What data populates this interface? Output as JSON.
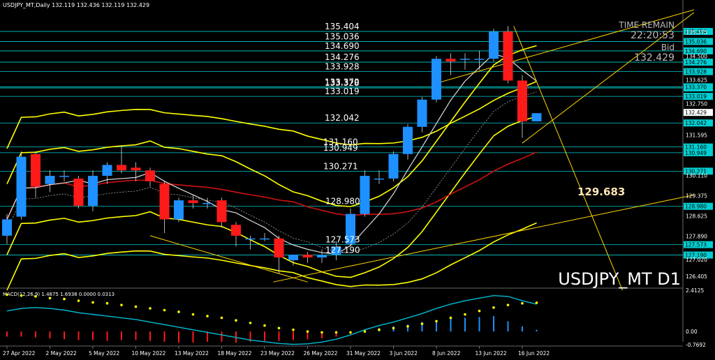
{
  "header": {
    "symbol_title": "USDJPY_MT,Daily  132.119 132.436 132.119 132.429"
  },
  "info": {
    "time_remain_label": "TIME REMAIN",
    "time_remain_value": "22:20:53",
    "bid_label": "Bid",
    "bid_value": "132.429"
  },
  "watermark": "USDJPY_MT D1",
  "target_label": "129.683",
  "colors": {
    "bg": "#000000",
    "bull": "#1e90ff",
    "bear": "#ff1a1a",
    "level": "#00ced1",
    "yellow": "#ffff00",
    "trend": "#ffd700",
    "ma_red": "#cc1111",
    "ma_white": "#dddddd",
    "axis": "#ffffff",
    "macd_line": "#00bcd4",
    "macd_signal": "#ffff00"
  },
  "chart_data": {
    "type": "candlestick",
    "symbol": "USDJPY_MT",
    "timeframe": "Daily",
    "ylim": [
      126.0,
      136.2
    ],
    "price_ticks": [
      "135.375",
      "134.500",
      "133.625",
      "132.750",
      "131.595",
      "130.110",
      "129.375",
      "128.625",
      "127.890",
      "127.020",
      "126.405"
    ],
    "current_price": "132.429",
    "date_labels": [
      {
        "i": 0,
        "label": "27 Apr 2022"
      },
      {
        "i": 3,
        "label": "2 May 2022"
      },
      {
        "i": 6,
        "label": "5 May 2022"
      },
      {
        "i": 9,
        "label": "10 May 2022"
      },
      {
        "i": 12,
        "label": "13 May 2022"
      },
      {
        "i": 15,
        "label": "18 May 2022"
      },
      {
        "i": 18,
        "label": "23 May 2022"
      },
      {
        "i": 21,
        "label": "26 May 2022"
      },
      {
        "i": 24,
        "label": "31 May 2022"
      },
      {
        "i": 27,
        "label": "3 Jun 2022"
      },
      {
        "i": 30,
        "label": "8 Jun 2022"
      },
      {
        "i": 33,
        "label": "13 Jun 2022"
      },
      {
        "i": 36,
        "label": "16 Jun 2022"
      }
    ],
    "candles": [
      {
        "o": 127.9,
        "h": 128.7,
        "l": 127.6,
        "c": 128.5
      },
      {
        "o": 128.6,
        "h": 131.0,
        "l": 128.5,
        "c": 130.8
      },
      {
        "o": 130.9,
        "h": 131.0,
        "l": 129.3,
        "c": 129.7
      },
      {
        "o": 129.8,
        "h": 130.3,
        "l": 129.5,
        "c": 130.1
      },
      {
        "o": 130.1,
        "h": 130.3,
        "l": 129.9,
        "c": 130.1
      },
      {
        "o": 130.0,
        "h": 130.1,
        "l": 128.9,
        "c": 129.0
      },
      {
        "o": 129.0,
        "h": 130.3,
        "l": 128.8,
        "c": 130.1
      },
      {
        "o": 130.1,
        "h": 130.6,
        "l": 129.8,
        "c": 130.5
      },
      {
        "o": 130.5,
        "h": 131.2,
        "l": 130.2,
        "c": 130.3
      },
      {
        "o": 130.4,
        "h": 130.6,
        "l": 129.9,
        "c": 130.3
      },
      {
        "o": 130.3,
        "h": 130.4,
        "l": 129.7,
        "c": 129.9
      },
      {
        "o": 129.8,
        "h": 129.9,
        "l": 128.0,
        "c": 128.5
      },
      {
        "o": 128.5,
        "h": 129.3,
        "l": 128.4,
        "c": 129.2
      },
      {
        "o": 129.2,
        "h": 129.4,
        "l": 128.9,
        "c": 129.1
      },
      {
        "o": 129.1,
        "h": 129.3,
        "l": 128.9,
        "c": 129.1
      },
      {
        "o": 129.2,
        "h": 129.3,
        "l": 128.2,
        "c": 128.4
      },
      {
        "o": 128.3,
        "h": 128.4,
        "l": 127.5,
        "c": 127.9
      },
      {
        "o": 127.8,
        "h": 127.9,
        "l": 127.4,
        "c": 127.8
      },
      {
        "o": 127.8,
        "h": 128.0,
        "l": 127.7,
        "c": 127.8
      },
      {
        "o": 127.8,
        "h": 127.9,
        "l": 126.5,
        "c": 127.1
      },
      {
        "o": 127.0,
        "h": 127.2,
        "l": 126.8,
        "c": 127.2
      },
      {
        "o": 127.2,
        "h": 127.3,
        "l": 126.9,
        "c": 127.1
      },
      {
        "o": 127.1,
        "h": 127.4,
        "l": 126.9,
        "c": 127.2
      },
      {
        "o": 127.2,
        "h": 127.7,
        "l": 127.0,
        "c": 127.5
      },
      {
        "o": 127.6,
        "h": 128.9,
        "l": 127.5,
        "c": 128.7
      },
      {
        "o": 128.7,
        "h": 130.3,
        "l": 128.6,
        "c": 130.1
      },
      {
        "o": 130.0,
        "h": 130.3,
        "l": 129.8,
        "c": 130.0
      },
      {
        "o": 130.0,
        "h": 131.0,
        "l": 129.9,
        "c": 130.9
      },
      {
        "o": 130.9,
        "h": 132.0,
        "l": 130.7,
        "c": 131.9
      },
      {
        "o": 131.9,
        "h": 133.0,
        "l": 131.7,
        "c": 132.9
      },
      {
        "o": 132.9,
        "h": 134.5,
        "l": 132.8,
        "c": 134.4
      },
      {
        "o": 134.4,
        "h": 134.6,
        "l": 133.8,
        "c": 134.3
      },
      {
        "o": 134.4,
        "h": 134.6,
        "l": 134.0,
        "c": 134.4
      },
      {
        "o": 134.4,
        "h": 134.7,
        "l": 134.0,
        "c": 134.4
      },
      {
        "o": 134.4,
        "h": 135.5,
        "l": 134.3,
        "c": 135.4
      },
      {
        "o": 135.4,
        "h": 135.6,
        "l": 133.5,
        "c": 133.6
      },
      {
        "o": 133.6,
        "h": 133.8,
        "l": 131.5,
        "c": 132.1
      },
      {
        "o": 132.1,
        "h": 132.4,
        "l": 132.1,
        "c": 132.4
      }
    ],
    "levels": [
      {
        "price": 135.404,
        "label": "135.404"
      },
      {
        "price": 135.036,
        "label": "135.036"
      },
      {
        "price": 134.69,
        "label": "134.690"
      },
      {
        "price": 134.276,
        "label": "134.276"
      },
      {
        "price": 133.928,
        "label": "133.928"
      },
      {
        "price": 133.328,
        "label": "133.328"
      },
      {
        "price": 133.37,
        "label": "133.370"
      },
      {
        "price": 133.019,
        "label": "133.019"
      },
      {
        "price": 132.042,
        "label": "132.042"
      },
      {
        "price": 131.16,
        "label": "131.160"
      },
      {
        "price": 130.949,
        "label": "130.949"
      },
      {
        "price": 130.271,
        "label": "130.271"
      },
      {
        "price": 128.98,
        "label": "128.980"
      },
      {
        "price": 127.573,
        "label": "127.573"
      },
      {
        "price": 127.19,
        "label": "127.190"
      }
    ],
    "macd": {
      "label": "MACD(12,26,9) 1.4875 1.6938 0.0000 0.0313",
      "ylim": [
        -0.7692,
        2.4125
      ],
      "ticks": [
        "2.4125",
        "0.00",
        "-0.7692"
      ],
      "main": [
        1.2,
        1.35,
        1.4,
        1.35,
        1.25,
        1.1,
        1.0,
        0.9,
        0.8,
        0.7,
        0.55,
        0.4,
        0.25,
        0.1,
        -0.05,
        -0.2,
        -0.35,
        -0.5,
        -0.6,
        -0.7,
        -0.75,
        -0.72,
        -0.62,
        -0.45,
        -0.2,
        0.1,
        0.35,
        0.55,
        0.8,
        1.05,
        1.35,
        1.6,
        1.8,
        1.95,
        2.1,
        2.05,
        1.8,
        1.6
      ],
      "signal": [
        2.15,
        2.1,
        2.05,
        1.95,
        1.9,
        1.8,
        1.7,
        1.65,
        1.55,
        1.45,
        1.35,
        1.25,
        1.15,
        1.0,
        0.9,
        0.8,
        0.65,
        0.5,
        0.35,
        0.2,
        0.1,
        0.0,
        -0.05,
        -0.05,
        -0.05,
        0.0,
        0.1,
        0.2,
        0.3,
        0.45,
        0.6,
        0.8,
        1.0,
        1.2,
        1.4,
        1.55,
        1.65,
        1.68
      ],
      "hist": [
        -0.3,
        -0.3,
        -0.35,
        -0.4,
        -0.45,
        -0.5,
        -0.5,
        -0.55,
        -0.5,
        -0.5,
        -0.55,
        -0.6,
        -0.65,
        -0.65,
        -0.6,
        -0.6,
        -0.65,
        -0.6,
        -0.55,
        -0.55,
        -0.5,
        -0.45,
        -0.4,
        -0.3,
        -0.15,
        0.1,
        0.2,
        0.3,
        0.4,
        0.55,
        0.65,
        0.75,
        0.8,
        0.85,
        0.9,
        0.6,
        0.3,
        0.1
      ]
    }
  }
}
